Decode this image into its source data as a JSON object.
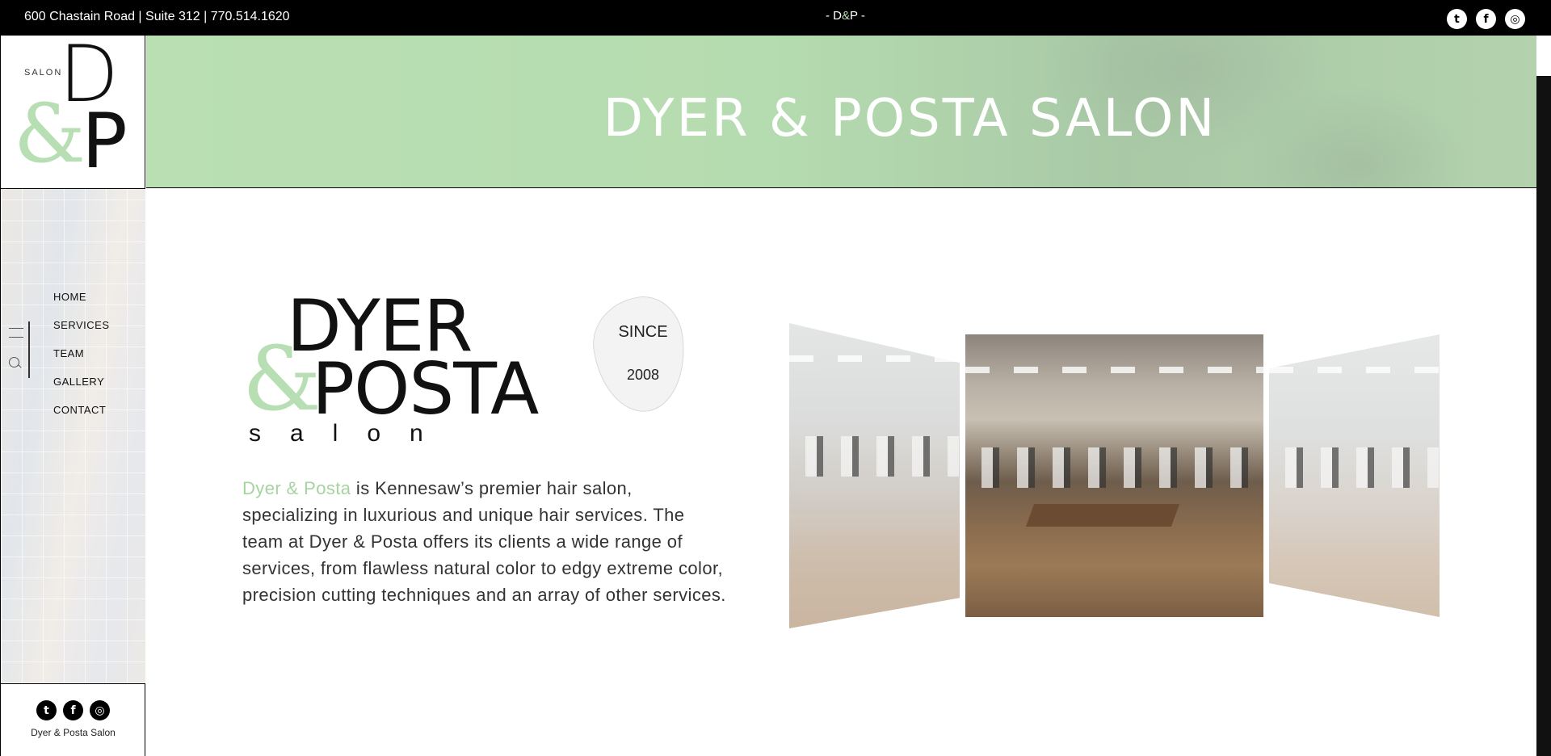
{
  "topbar": {
    "address": "600 Chastain Road | Suite 312 | 770.514.1620",
    "center_prefix": "- D",
    "center_amp": "&",
    "center_suffix": "P -",
    "social": [
      "twitter-icon",
      "facebook-icon",
      "instagram-icon"
    ]
  },
  "sidebar": {
    "logo": {
      "salon": "SALON",
      "d": "D",
      "amp": "&",
      "p": "P"
    },
    "nav": [
      "HOME",
      "SERVICES",
      "TEAM",
      "GALLERY",
      "CONTACT"
    ],
    "footer_caption": "Dyer & Posta Salon"
  },
  "hero": {
    "title": "DYER & POSTA SALON"
  },
  "brand": {
    "dyer": "DYER",
    "amp": "&",
    "posta": "POSTA",
    "salon": "salon",
    "since": "SINCE",
    "year": "2008"
  },
  "description": {
    "highlight": "Dyer & Posta",
    "text": " is Kennesaw’s premier hair salon, specializing in luxurious and unique hair services. The team at Dyer & Posta offers its clients a wide range of services, from flawless natural color to edgy extreme color, precision cutting techniques and an array of other services."
  },
  "colors": {
    "accent_green": "#b8dfb3",
    "topbar": "#000000"
  }
}
